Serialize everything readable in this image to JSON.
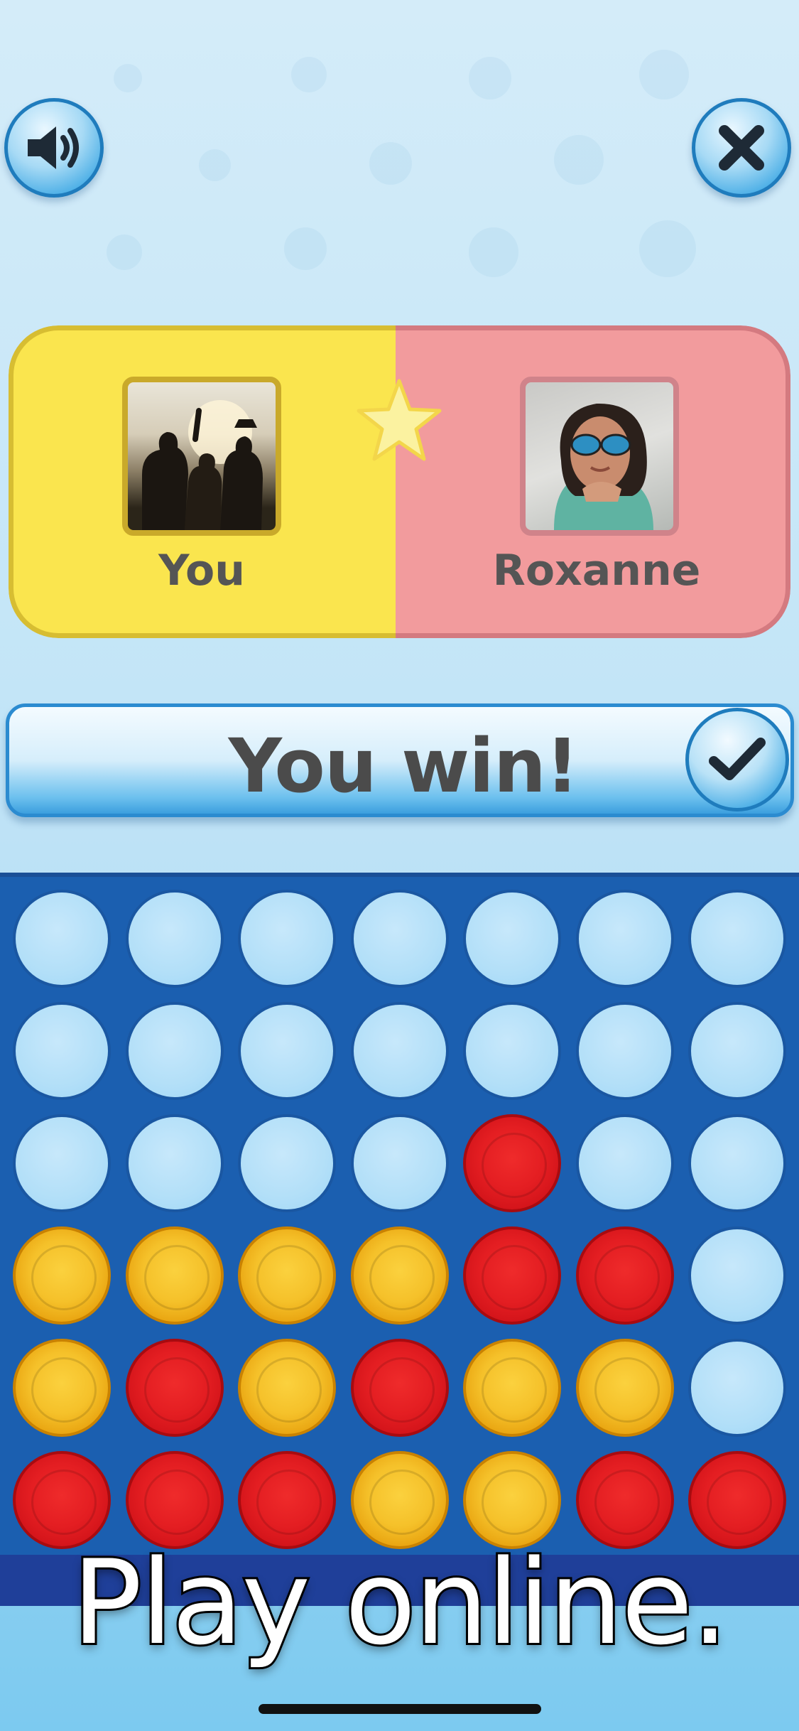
{
  "players": {
    "you": {
      "name": "You",
      "color": "#fae54e"
    },
    "opponent": {
      "name": "Roxanne",
      "color": "#f29b9d"
    }
  },
  "result": {
    "text": "You win!"
  },
  "board": {
    "columns": 7,
    "rows": 6,
    "cells": [
      [
        "empty",
        "empty",
        "empty",
        "empty",
        "empty",
        "empty",
        "empty"
      ],
      [
        "empty",
        "empty",
        "empty",
        "empty",
        "empty",
        "empty",
        "empty"
      ],
      [
        "empty",
        "empty",
        "empty",
        "empty",
        "red",
        "empty",
        "empty"
      ],
      [
        "yellow",
        "yellow",
        "yellow",
        "yellow",
        "red",
        "red",
        "empty"
      ],
      [
        "yellow",
        "red",
        "yellow",
        "red",
        "yellow",
        "yellow",
        "empty"
      ],
      [
        "red",
        "red",
        "red",
        "yellow",
        "yellow",
        "red",
        "red"
      ]
    ]
  },
  "tagline": "Play online.",
  "icons": {
    "sound": "speaker-icon",
    "close": "close-icon",
    "confirm": "checkmark-icon",
    "star": "star-icon"
  }
}
